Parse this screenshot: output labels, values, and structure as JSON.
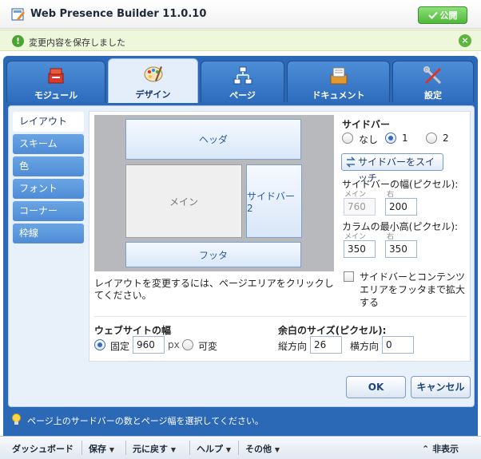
{
  "app": {
    "title": "Web Presence Builder 11.0.10",
    "publish_label": "公開"
  },
  "notice": {
    "text": "変更内容を保存しました"
  },
  "tabs": [
    {
      "label": "モジュール"
    },
    {
      "label": "デザイン"
    },
    {
      "label": "ページ"
    },
    {
      "label": "ドキュメント"
    },
    {
      "label": "設定"
    }
  ],
  "sidenav": [
    {
      "label": "レイアウト"
    },
    {
      "label": "スキーム"
    },
    {
      "label": "色"
    },
    {
      "label": "フォント"
    },
    {
      "label": "コーナー"
    },
    {
      "label": "枠線"
    }
  ],
  "preview": {
    "header": "ヘッダ",
    "main": "メイン",
    "sidebar": "サイドバー 2",
    "footer": "フッタ"
  },
  "layout_hint": "レイアウトを変更するには、ページエリアをクリックしてください。",
  "sidebar": {
    "title": "サイドバー",
    "options": [
      "なし",
      "1",
      "2"
    ],
    "selected": "1",
    "switch_label": "サイドバーをスイッチ",
    "width_title": "サイドバーの幅(ピクセル):",
    "main_label": "メイン",
    "right_label": "右",
    "width_main": "760",
    "width_right": "200",
    "minheight_title": "カラムの最小高(ピクセル):",
    "minheight_main": "350",
    "minheight_right": "350",
    "extend_label": "サイドバーとコンテンツエリアをフッタまで拡大する"
  },
  "site_width": {
    "title": "ウェブサイトの幅",
    "fixed_label": "固定",
    "fixed_value": "960",
    "unit": "px",
    "variable_label": "可変"
  },
  "margins": {
    "title": "余白のサイズ(ピクセル):",
    "vertical_label": "縦方向",
    "vertical_value": "26",
    "horizontal_label": "横方向",
    "horizontal_value": "0"
  },
  "buttons": {
    "ok": "OK",
    "cancel": "キャンセル"
  },
  "hint": "ページ上のサードバーの数とページ幅を選択してください。",
  "toolbar": {
    "dashboard": "ダッシュボード",
    "save": "保存",
    "undo": "元に戻す",
    "help": "ヘルプ",
    "other": "その他",
    "hide": "非表示"
  },
  "colors": {
    "accent": "#2b68b5",
    "notice_bg": "#eef6db",
    "publish": "#4fb83a"
  }
}
